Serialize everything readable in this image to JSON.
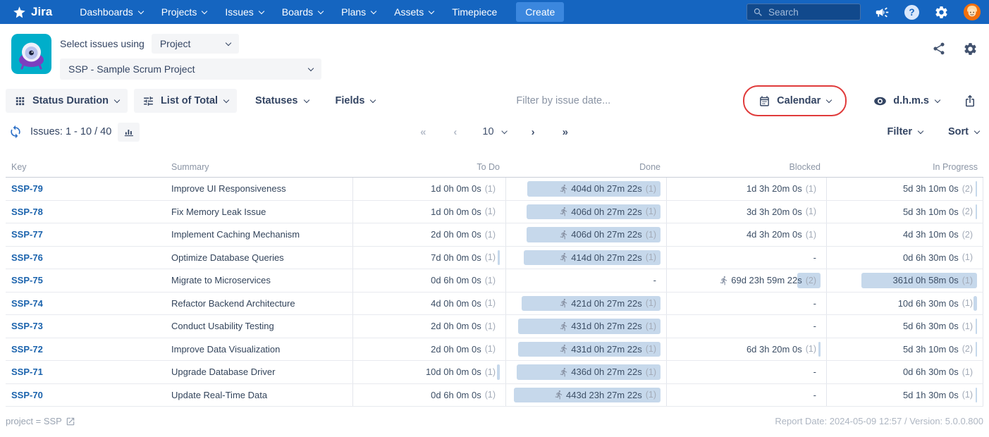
{
  "nav": {
    "brand": "Jira",
    "items": [
      {
        "label": "Dashboards",
        "chevron": true
      },
      {
        "label": "Projects",
        "chevron": true
      },
      {
        "label": "Issues",
        "chevron": true
      },
      {
        "label": "Boards",
        "chevron": true
      },
      {
        "label": "Plans",
        "chevron": true
      },
      {
        "label": "Assets",
        "chevron": true
      },
      {
        "label": "Timepiece",
        "chevron": false
      }
    ],
    "create_label": "Create",
    "search_placeholder": "Search"
  },
  "header": {
    "select_label": "Select issues using",
    "mode_value": "Project",
    "project_value": "SSP - Sample Scrum Project"
  },
  "toolbar": {
    "report_type": "Status Duration",
    "list_mode": "List of Total",
    "statuses": "Statuses",
    "fields": "Fields",
    "date_filter_placeholder": "Filter by issue date...",
    "calendar": "Calendar",
    "units": "d.h.m.s"
  },
  "issuesbar": {
    "issues_text": "Issues: 1 - 10 / 40",
    "pagination": {
      "first": "«",
      "prev": "‹",
      "page_size": "10",
      "next": "›",
      "last": "»"
    },
    "filter": "Filter",
    "sort": "Sort"
  },
  "icons": {
    "search": "magnifier",
    "megaphone": "announcement",
    "help": "question-circle",
    "gear": "settings-cog",
    "share": "share-nodes",
    "grid": "apps-grid",
    "sliders": "tune",
    "calendar": "calendar-grid",
    "eye": "visibility",
    "export": "share-up-arrow",
    "refresh": "sync-arrows",
    "chart": "bar-chart",
    "runner": "running-person",
    "external": "open-in-new"
  },
  "colors": {
    "nav_blue": "#1565c0",
    "create_blue": "#3b87de",
    "bar_fill": "#c6d8eb",
    "annotation_red": "#e03b3b",
    "link_blue": "#1b63ad",
    "app_teal": "#00aeca"
  },
  "table": {
    "columns": [
      "Key",
      "Summary",
      "To Do",
      "Done",
      "Blocked",
      "In Progress"
    ],
    "max_days_scale": 450,
    "rows": [
      {
        "key": "SSP-79",
        "summary": "Improve UI Responsiveness",
        "cells": [
          {
            "text": "1d 0h 0m 0s",
            "count": "(1)",
            "days": 1.0
          },
          {
            "text": "404d 0h 27m 22s",
            "count": "(1)",
            "days": 404.02,
            "runner": true
          },
          {
            "text": "1d 3h 20m 0s",
            "count": "(1)",
            "days": 1.14
          },
          {
            "text": "5d 3h 10m 0s",
            "count": "(2)",
            "days": 5.13
          }
        ]
      },
      {
        "key": "SSP-78",
        "summary": "Fix Memory Leak Issue",
        "cells": [
          {
            "text": "1d 0h 0m 0s",
            "count": "(1)",
            "days": 1.0
          },
          {
            "text": "406d 0h 27m 22s",
            "count": "(1)",
            "days": 406.02,
            "runner": true
          },
          {
            "text": "3d 3h 20m 0s",
            "count": "(1)",
            "days": 3.14
          },
          {
            "text": "5d 3h 10m 0s",
            "count": "(2)",
            "days": 5.13
          }
        ]
      },
      {
        "key": "SSP-77",
        "summary": "Implement Caching Mechanism",
        "cells": [
          {
            "text": "2d 0h 0m 0s",
            "count": "(1)",
            "days": 2.0
          },
          {
            "text": "406d 0h 27m 22s",
            "count": "(1)",
            "days": 406.02,
            "runner": true
          },
          {
            "text": "4d 3h 20m 0s",
            "count": "(1)",
            "days": 4.14
          },
          {
            "text": "4d 3h 10m 0s",
            "count": "(2)",
            "days": 4.13
          }
        ]
      },
      {
        "key": "SSP-76",
        "summary": "Optimize Database Queries",
        "cells": [
          {
            "text": "7d 0h 0m 0s",
            "count": "(1)",
            "days": 7.0
          },
          {
            "text": "414d 0h 27m 22s",
            "count": "(1)",
            "days": 414.02,
            "runner": true
          },
          {
            "dash": true
          },
          {
            "text": "0d 6h 30m 0s",
            "count": "(1)",
            "days": 0.27
          }
        ]
      },
      {
        "key": "SSP-75",
        "summary": "Migrate to Microservices",
        "cells": [
          {
            "text": "0d 6h 0m 0s",
            "count": "(1)",
            "days": 0.25
          },
          {
            "dash": true
          },
          {
            "text": "69d 23h 59m 22s",
            "count": "(2)",
            "days": 70.0,
            "runner": true
          },
          {
            "text": "361d 0h 58m 0s",
            "count": "(1)",
            "days": 361.04
          }
        ]
      },
      {
        "key": "SSP-74",
        "summary": "Refactor Backend Architecture",
        "cells": [
          {
            "text": "4d 0h 0m 0s",
            "count": "(1)",
            "days": 4.0
          },
          {
            "text": "421d 0h 27m 22s",
            "count": "(1)",
            "days": 421.02,
            "runner": true
          },
          {
            "dash": true
          },
          {
            "text": "10d 6h 30m 0s",
            "count": "(1)",
            "days": 10.27
          }
        ]
      },
      {
        "key": "SSP-73",
        "summary": "Conduct Usability Testing",
        "cells": [
          {
            "text": "2d 0h 0m 0s",
            "count": "(1)",
            "days": 2.0
          },
          {
            "text": "431d 0h 27m 22s",
            "count": "(1)",
            "days": 431.02,
            "runner": true
          },
          {
            "dash": true
          },
          {
            "text": "5d 6h 30m 0s",
            "count": "(1)",
            "days": 5.27
          }
        ]
      },
      {
        "key": "SSP-72",
        "summary": "Improve Data Visualization",
        "cells": [
          {
            "text": "2d 0h 0m 0s",
            "count": "(1)",
            "days": 2.0
          },
          {
            "text": "431d 0h 27m 22s",
            "count": "(1)",
            "days": 431.02,
            "runner": true
          },
          {
            "text": "6d 3h 20m 0s",
            "count": "(1)",
            "days": 6.14
          },
          {
            "text": "5d 3h 10m 0s",
            "count": "(2)",
            "days": 5.13
          }
        ]
      },
      {
        "key": "SSP-71",
        "summary": "Upgrade Database Driver",
        "cells": [
          {
            "text": "10d 0h 0m 0s",
            "count": "(1)",
            "days": 10.0
          },
          {
            "text": "436d 0h 27m 22s",
            "count": "(1)",
            "days": 436.02,
            "runner": true
          },
          {
            "dash": true
          },
          {
            "text": "0d 6h 30m 0s",
            "count": "(1)",
            "days": 0.27
          }
        ]
      },
      {
        "key": "SSP-70",
        "summary": "Update Real-Time Data",
        "cells": [
          {
            "text": "0d 6h 0m 0s",
            "count": "(1)",
            "days": 0.25
          },
          {
            "text": "443d 23h 27m 22s",
            "count": "(1)",
            "days": 443.98,
            "runner": true
          },
          {
            "dash": true
          },
          {
            "text": "5d 1h 30m 0s",
            "count": "(1)",
            "days": 5.06
          }
        ]
      }
    ]
  },
  "footer": {
    "query": "project = SSP",
    "report_info": "Report Date: 2024-05-09 12:57 / Version: 5.0.0.800"
  }
}
